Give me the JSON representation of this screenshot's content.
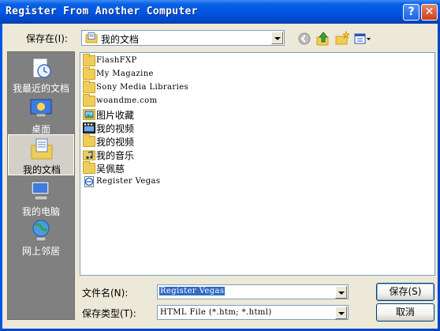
{
  "window": {
    "title": "Register From Another Computer",
    "help_glyph": "?",
    "close_glyph": "✕"
  },
  "save_in": {
    "label": "保存在(I):",
    "value": "我的文档",
    "icon": "documents-folder-icon"
  },
  "toolbar": {
    "icons": [
      "back-icon",
      "up-folder-icon",
      "new-folder-icon",
      "views-menu-icon"
    ]
  },
  "places": [
    {
      "label": "我最近的文档",
      "icon": "recent-documents-icon",
      "selected": false
    },
    {
      "label": "桌面",
      "icon": "desktop-icon",
      "selected": false
    },
    {
      "label": "我的文档",
      "icon": "my-documents-icon",
      "selected": true
    },
    {
      "label": "我的电脑",
      "icon": "my-computer-icon",
      "selected": false
    },
    {
      "label": "网上邻居",
      "icon": "network-places-icon",
      "selected": false
    }
  ],
  "files": [
    {
      "name": "FlashFXP",
      "icon": "folder-icon"
    },
    {
      "name": "My Magazine",
      "icon": "folder-icon"
    },
    {
      "name": "Sony Media Libraries",
      "icon": "folder-icon"
    },
    {
      "name": "woandme.com",
      "icon": "folder-icon"
    },
    {
      "name": "图片收藏",
      "icon": "pictures-folder-icon"
    },
    {
      "name": "我的视频",
      "icon": "video-folder-icon"
    },
    {
      "name": "我的视频",
      "icon": "folder-icon"
    },
    {
      "name": "我的音乐",
      "icon": "music-folder-icon"
    },
    {
      "name": "吴佩慈",
      "icon": "folder-icon"
    },
    {
      "name": "Register Vegas",
      "icon": "html-file-icon"
    }
  ],
  "filename": {
    "label": "文件名(N):",
    "value": "Register Vegas"
  },
  "filetype": {
    "label": "保存类型(T):",
    "value": "HTML File (*.htm; *.html)"
  },
  "buttons": {
    "save": "保存(S)",
    "cancel": "取消"
  },
  "colors": {
    "title_bar": "#0055e5",
    "selection": "#316ac5",
    "dialog_bg": "#ece9d8"
  }
}
